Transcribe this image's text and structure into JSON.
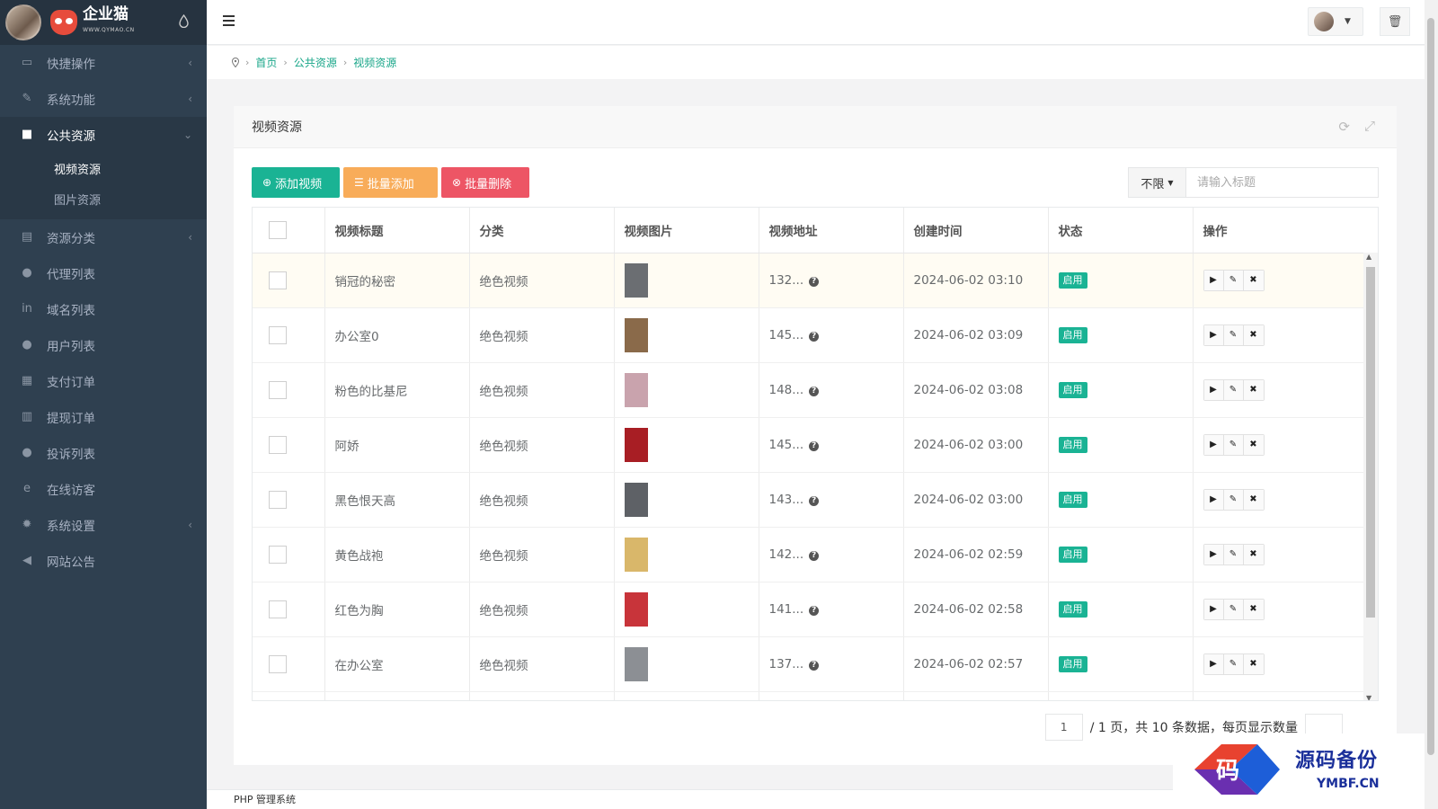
{
  "brand": {
    "name": "企业猫",
    "sub": "WWW.QYMAO.CN"
  },
  "sidebar": {
    "items": [
      {
        "label": "快捷操作",
        "icon": "folder-open-icon",
        "arrow": true
      },
      {
        "label": "系统功能",
        "icon": "wrench-icon",
        "arrow": true
      },
      {
        "label": "公共资源",
        "icon": "video-camera-icon",
        "arrow": true,
        "active": true
      },
      {
        "label": "资源分类",
        "icon": "list-icon",
        "arrow": true
      },
      {
        "label": "代理列表",
        "icon": "users-icon",
        "arrow": false
      },
      {
        "label": "域名列表",
        "icon": "linkedin-icon",
        "arrow": false
      },
      {
        "label": "用户列表",
        "icon": "user-icon",
        "arrow": false
      },
      {
        "label": "支付订单",
        "icon": "database-icon",
        "arrow": false
      },
      {
        "label": "提现订单",
        "icon": "bank-icon",
        "arrow": false
      },
      {
        "label": "投诉列表",
        "icon": "info-circle-icon",
        "arrow": false
      },
      {
        "label": "在线访客",
        "icon": "ie-icon",
        "arrow": false
      },
      {
        "label": "系统设置",
        "icon": "gear-icon",
        "arrow": true
      },
      {
        "label": "网站公告",
        "icon": "bullhorn-icon",
        "arrow": false
      }
    ],
    "sub_items": [
      {
        "label": "视频资源",
        "active": true
      },
      {
        "label": "图片资源",
        "active": false
      }
    ]
  },
  "breadcrumb": [
    "首页",
    "公共资源",
    "视频资源"
  ],
  "panel": {
    "title": "视频资源"
  },
  "toolbar": {
    "add": "添加视频",
    "batch_add": "批量添加",
    "batch_delete": "批量删除"
  },
  "filter": {
    "select_value": "不限",
    "placeholder": "请输入标题"
  },
  "table": {
    "headers": [
      "视频标题",
      "分类",
      "视频图片",
      "视频地址",
      "创建时间",
      "状态",
      "操作"
    ],
    "rows": [
      {
        "title": "销冠的秘密",
        "category": "绝色视频",
        "url": "132...",
        "created": "2024-06-02 03:10",
        "status": "启用",
        "thumb": "#6b6e72"
      },
      {
        "title": "办公室0",
        "category": "绝色视频",
        "url": "145...",
        "created": "2024-06-02 03:09",
        "status": "启用",
        "thumb": "#8a6a4a"
      },
      {
        "title": "粉色的比基尼",
        "category": "绝色视频",
        "url": "148...",
        "created": "2024-06-02 03:08",
        "status": "启用",
        "thumb": "#c9a3ad"
      },
      {
        "title": "阿娇",
        "category": "绝色视频",
        "url": "145...",
        "created": "2024-06-02 03:00",
        "status": "启用",
        "thumb": "#a81e24"
      },
      {
        "title": "黑色恨天高",
        "category": "绝色视频",
        "url": "143...",
        "created": "2024-06-02 03:00",
        "status": "启用",
        "thumb": "#5e6166"
      },
      {
        "title": "黄色战袍",
        "category": "绝色视频",
        "url": "142...",
        "created": "2024-06-02 02:59",
        "status": "启用",
        "thumb": "#d9b76a"
      },
      {
        "title": "红色为胸",
        "category": "绝色视频",
        "url": "141...",
        "created": "2024-06-02 02:58",
        "status": "启用",
        "thumb": "#c8343a"
      },
      {
        "title": "在办公室",
        "category": "绝色视频",
        "url": "137...",
        "created": "2024-06-02 02:57",
        "status": "启用",
        "thumb": "#8c8f94"
      },
      {
        "title": "",
        "category": "",
        "url": "",
        "created": "",
        "status": "",
        "thumb": "#7a7d82"
      }
    ]
  },
  "pager": {
    "current": "1",
    "info": "/ 1 页，共 10 条数据，每页显示数量"
  },
  "footer": {
    "text": "PHP 管理系统"
  },
  "watermark": {
    "title": "源码备份",
    "sub": "YMBF.CN",
    "mark": "码"
  },
  "colors": {
    "sidebar": "#2f4050",
    "primary": "#1ab394",
    "warning": "#f8ac59",
    "danger": "#ed5565"
  }
}
